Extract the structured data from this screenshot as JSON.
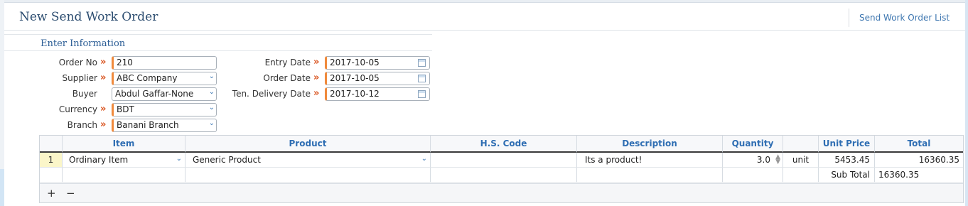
{
  "header": {
    "title": "New Send Work Order",
    "list_link": "Send Work Order List"
  },
  "section": {
    "title": "Enter Information"
  },
  "form": {
    "order_no": {
      "label": "Order No",
      "value": "210"
    },
    "supplier": {
      "label": "Supplier",
      "value": "ABC Company"
    },
    "buyer": {
      "label": "Buyer",
      "value": "Abdul Gaffar-None"
    },
    "currency": {
      "label": "Currency",
      "value": "BDT"
    },
    "branch": {
      "label": "Branch",
      "value": "Banani Branch"
    },
    "entry_date": {
      "label": "Entry Date",
      "value": "2017-10-05"
    },
    "order_date": {
      "label": "Order Date",
      "value": "2017-10-05"
    },
    "delivery_date": {
      "label": "Ten. Delivery Date",
      "value": "2017-10-12"
    },
    "required_marker": "»"
  },
  "grid": {
    "columns": [
      "Item",
      "Product",
      "H.S. Code",
      "Description",
      "Quantity",
      "",
      "Unit Price",
      "Total"
    ],
    "rows": [
      {
        "num": "1",
        "item": "Ordinary Item",
        "product": "Generic Product",
        "hs_code": "",
        "description": "Its a product!",
        "quantity": "3.0",
        "unit": "unit",
        "unit_price": "5453.45",
        "total": "16360.35"
      }
    ],
    "subtotal_label": "Sub Total",
    "subtotal_value": "16360.35",
    "add_button": "+",
    "remove_button": "−"
  },
  "colors": {
    "title": "#2c4d70",
    "link": "#3d76b0",
    "header_text": "#2f6eb3",
    "required": "#d9531e",
    "row_highlight": "#fbf6c9"
  },
  "icons": [
    "dropdown-arrow-icon",
    "calendar-icon",
    "spinner-icon",
    "required-marker-icon"
  ]
}
